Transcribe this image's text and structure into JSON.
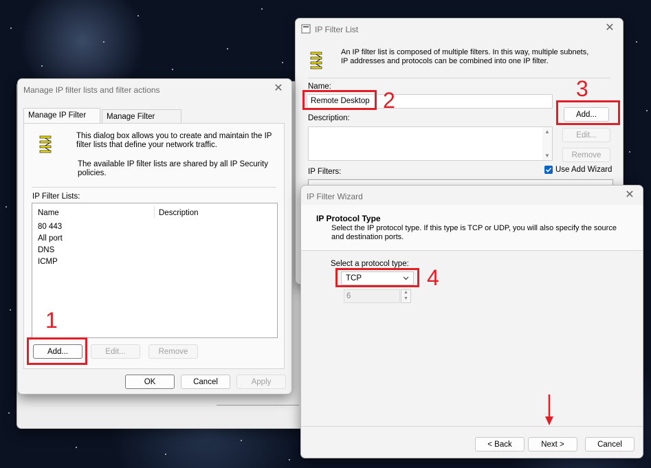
{
  "manage_dialog": {
    "title": "Manage IP filter lists and filter actions",
    "tabs": [
      "Manage IP Filter Lists",
      "Manage Filter Actions"
    ],
    "description_1": "This dialog box allows you to create and maintain the IP filter lists that define your network traffic.",
    "description_2": "The available IP filter lists are shared by all IP Security policies.",
    "lists_label": "IP Filter Lists:",
    "columns": [
      "Name",
      "Description"
    ],
    "rows": [
      "80 443",
      "All port",
      "DNS",
      "ICMP"
    ],
    "add_label": "Add...",
    "edit_label": "Edit...",
    "remove_label": "Remove",
    "ok_label": "OK",
    "cancel_label": "Cancel",
    "apply_label": "Apply"
  },
  "filter_list_dialog": {
    "title": "IP Filter List",
    "description": "An IP filter list is composed of multiple filters. In this way, multiple subnets, IP addresses and protocols can be combined into one IP filter.",
    "name_label": "Name:",
    "name_value": "Remote Desktop",
    "description_label": "Description:",
    "filters_label": "IP Filters:",
    "add_label": "Add...",
    "edit_label": "Edit...",
    "remove_label": "Remove",
    "wizard_checkbox_label": "Use Add Wizard",
    "wizard_checked": true
  },
  "wizard_dialog": {
    "title": "IP Filter Wizard",
    "heading": "IP Protocol Type",
    "subheading": "Select the IP protocol type. If this type is TCP or UDP, you will also specify the source and destination ports.",
    "protocol_label": "Select a protocol type:",
    "protocol_value": "TCP",
    "protocol_number": "6",
    "back_label": "< Back",
    "next_label": "Next >",
    "cancel_label": "Cancel"
  },
  "annotations": {
    "step_1": "1",
    "step_2": "2",
    "step_3": "3",
    "step_4": "4",
    "color": "#e21f26"
  }
}
